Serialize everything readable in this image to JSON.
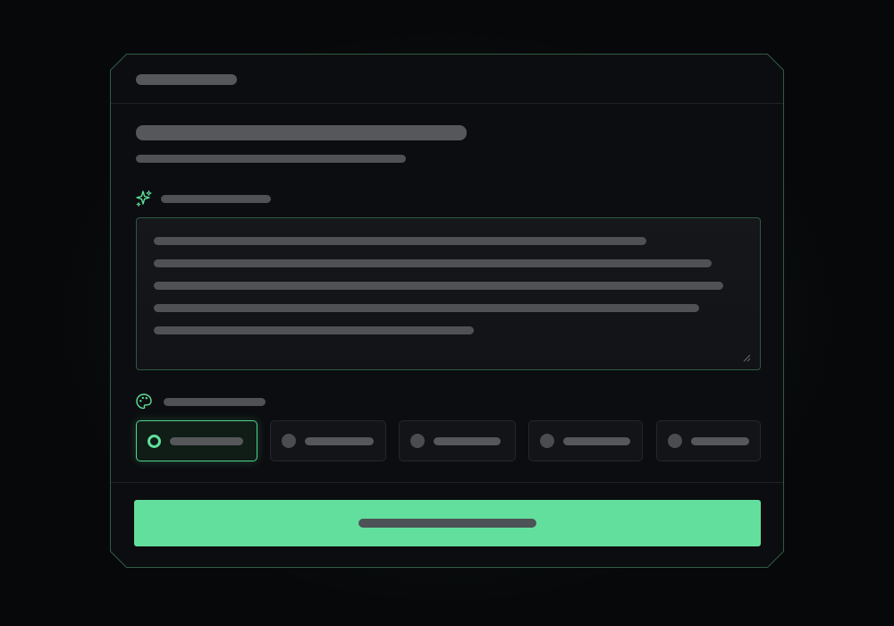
{
  "form": {
    "header_label": "",
    "title": "",
    "subtitle": "",
    "prompt_section": {
      "icon": "sparkles-icon",
      "label": "",
      "textarea_value": "",
      "textarea_placeholder": ""
    },
    "style_section": {
      "icon": "palette-icon",
      "label": "",
      "options": [
        {
          "label": "",
          "selected": true
        },
        {
          "label": "",
          "selected": false
        },
        {
          "label": "",
          "selected": false
        },
        {
          "label": "",
          "selected": false
        },
        {
          "label": "",
          "selected": false
        }
      ]
    },
    "submit_label": ""
  },
  "colors": {
    "accent": "#63df9d",
    "accent_border": "#4fd38d",
    "panel_bg": "#0c0d10",
    "page_bg": "#07080a",
    "placeholder_bar": "#55575b"
  }
}
